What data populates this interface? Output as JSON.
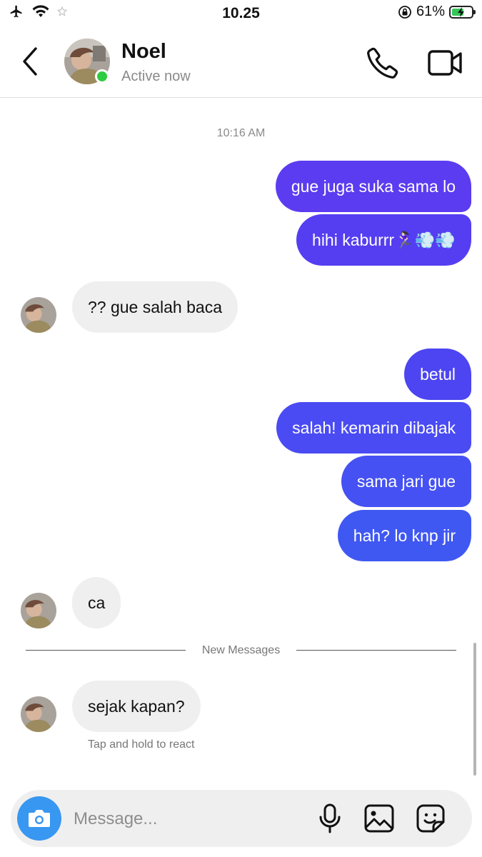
{
  "status_bar": {
    "time": "10.25",
    "battery": "61%",
    "battery_level": 0.61
  },
  "header": {
    "contact_name": "Noel",
    "contact_status": "Active now"
  },
  "chat": {
    "timestamp": "10:16 AM",
    "messages": [
      {
        "sender": "me",
        "text": "gue juga suka sama lo"
      },
      {
        "sender": "me",
        "text": "hihi kaburrr🏃🏻‍♀️💨💨"
      },
      {
        "sender": "contact",
        "text": "?? gue salah baca"
      },
      {
        "sender": "me",
        "text": "betul"
      },
      {
        "sender": "me",
        "text": "salah! kemarin dibajak"
      },
      {
        "sender": "me",
        "text": "sama jari gue"
      },
      {
        "sender": "me",
        "text": "hah? lo knp jir"
      },
      {
        "sender": "contact",
        "text": "ca"
      },
      {
        "sender": "contact",
        "text": "sejak kapan?"
      }
    ],
    "new_messages_label": "New Messages",
    "react_hint": "Tap and hold to react"
  },
  "composer": {
    "placeholder": "Message..."
  },
  "colors": {
    "accent": "#3897f0",
    "online": "#2ecc40",
    "bubble_in": "#efefef",
    "bubble_out_top": "#5b3cf0",
    "bubble_out_bottom": "#3f5cf2"
  },
  "icons": [
    "airplane-icon",
    "wifi-icon",
    "orientation-lock-icon",
    "battery-icon",
    "back-icon",
    "phone-icon",
    "video-camera-icon",
    "camera-icon",
    "microphone-icon",
    "image-icon",
    "sticker-icon"
  ]
}
